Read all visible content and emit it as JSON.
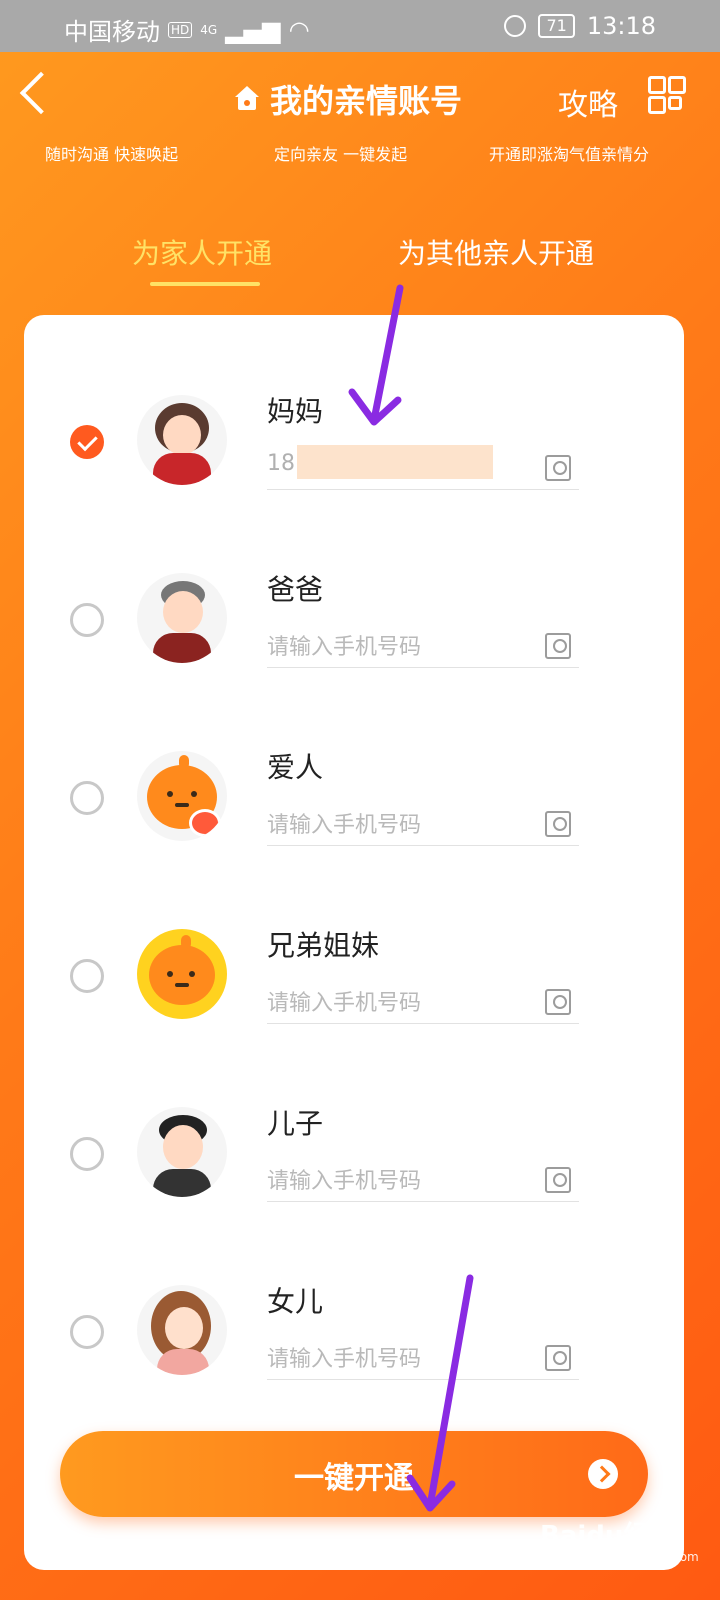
{
  "status_bar": {
    "carrier": "中国移动",
    "hd": "HD",
    "network": "4G",
    "battery": "71",
    "time": "13:18"
  },
  "header": {
    "title": "我的亲情账号",
    "guide": "攻略",
    "subtitles": [
      "随时沟通 快速唤起",
      "定向亲友 一键发起",
      "开通即涨淘气值亲情分"
    ]
  },
  "tabs": [
    {
      "label": "为家人开通",
      "active": true
    },
    {
      "label": "为其他亲人开通",
      "active": false
    }
  ],
  "members": [
    {
      "name": "妈妈",
      "phone": "18",
      "checked": true
    },
    {
      "name": "爸爸",
      "placeholder": "请输入手机号码",
      "checked": false
    },
    {
      "name": "爱人",
      "placeholder": "请输入手机号码",
      "checked": false
    },
    {
      "name": "兄弟姐妹",
      "placeholder": "请输入手机号码",
      "checked": false
    },
    {
      "name": "儿子",
      "placeholder": "请输入手机号码",
      "checked": false
    },
    {
      "name": "女儿",
      "placeholder": "请输入手机号码",
      "checked": false
    }
  ],
  "cta": {
    "label": "一键开通"
  },
  "watermark": {
    "brand": "Baidu经验",
    "url": "jingyan.baidu.com"
  },
  "colors": {
    "accent": "#ff7a18",
    "tab_active": "#ffe266",
    "annotation_arrow": "#8a2be2"
  }
}
